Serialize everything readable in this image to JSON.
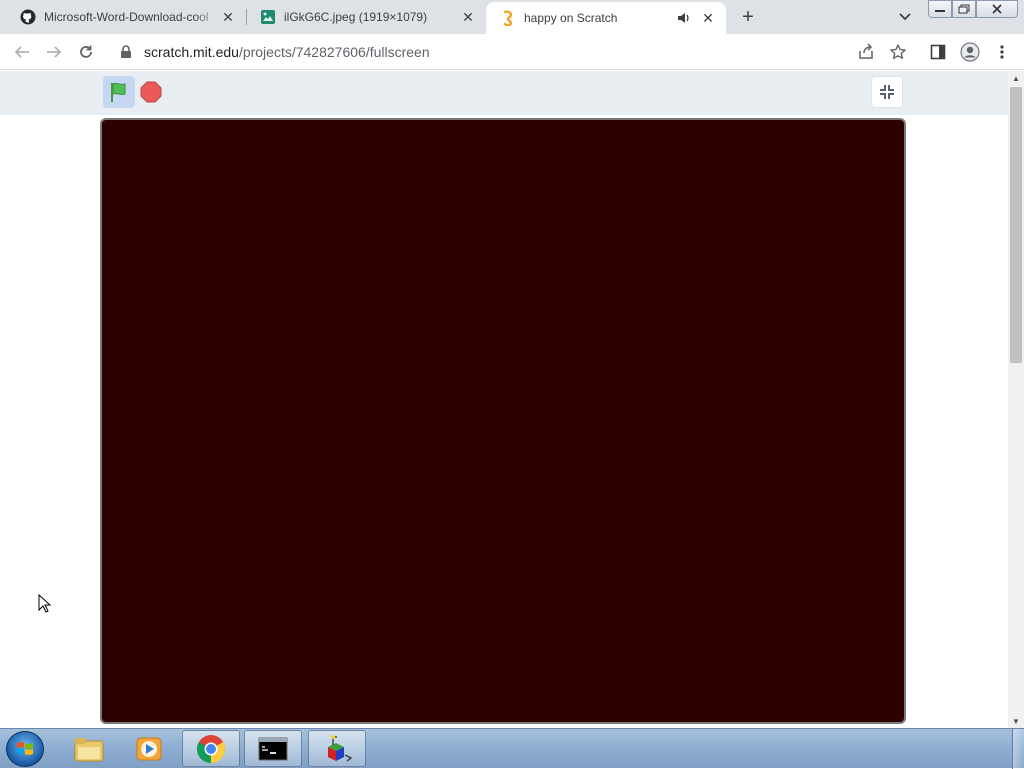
{
  "browser": {
    "tabs": [
      {
        "title": "Microsoft-Word-Download-cool",
        "icon": "github-icon"
      },
      {
        "title": "ilGkG6C.jpeg (1919×1079)",
        "icon": "image-icon"
      },
      {
        "title": "happy on Scratch",
        "icon": "scratch-icon",
        "audio": true
      }
    ],
    "url": {
      "host": "scratch.mit.edu",
      "path": "/projects/742827606/fullscreen"
    }
  },
  "scratch": {
    "stage_color": "#2e0101",
    "flag_color": "#4cbf56",
    "stop_color": "#ec5959"
  },
  "taskbar": {
    "apps": [
      "windows-explorer",
      "windows-media-player",
      "google-chrome",
      "command-prompt",
      "3d-app"
    ]
  }
}
